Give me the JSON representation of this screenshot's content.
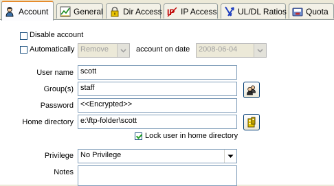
{
  "tabs": [
    {
      "label": "Account",
      "icon": "user-icon",
      "active": true
    },
    {
      "label": "General",
      "icon": "chart-icon"
    },
    {
      "label": "Dir Access",
      "icon": "lock-icon"
    },
    {
      "label": "IP Access",
      "icon": "ip-icon"
    },
    {
      "label": "UL/DL Ratios",
      "icon": "ratio-arrows-icon"
    },
    {
      "label": "Quota",
      "icon": "disk-icon"
    }
  ],
  "account": {
    "disable_label": "Disable account",
    "disable_checked": false,
    "auto_label": "Automatically",
    "auto_checked": false,
    "auto_action": "Remove",
    "on_date_label": "account on date",
    "date_value": "2008-06-04"
  },
  "form": {
    "username_label": "User name",
    "username_value": "scott",
    "groups_label": "Group(s)",
    "groups_value": "staff",
    "password_label": "Password",
    "password_value": "<<Encrypted>>",
    "homedir_label": "Home directory",
    "homedir_value": "e:\\ftp-folder\\scott",
    "lock_label": "Lock user in home directory",
    "lock_checked": true,
    "privilege_label": "Privilege",
    "privilege_value": "No Privilege",
    "notes_label": "Notes",
    "notes_value": ""
  }
}
